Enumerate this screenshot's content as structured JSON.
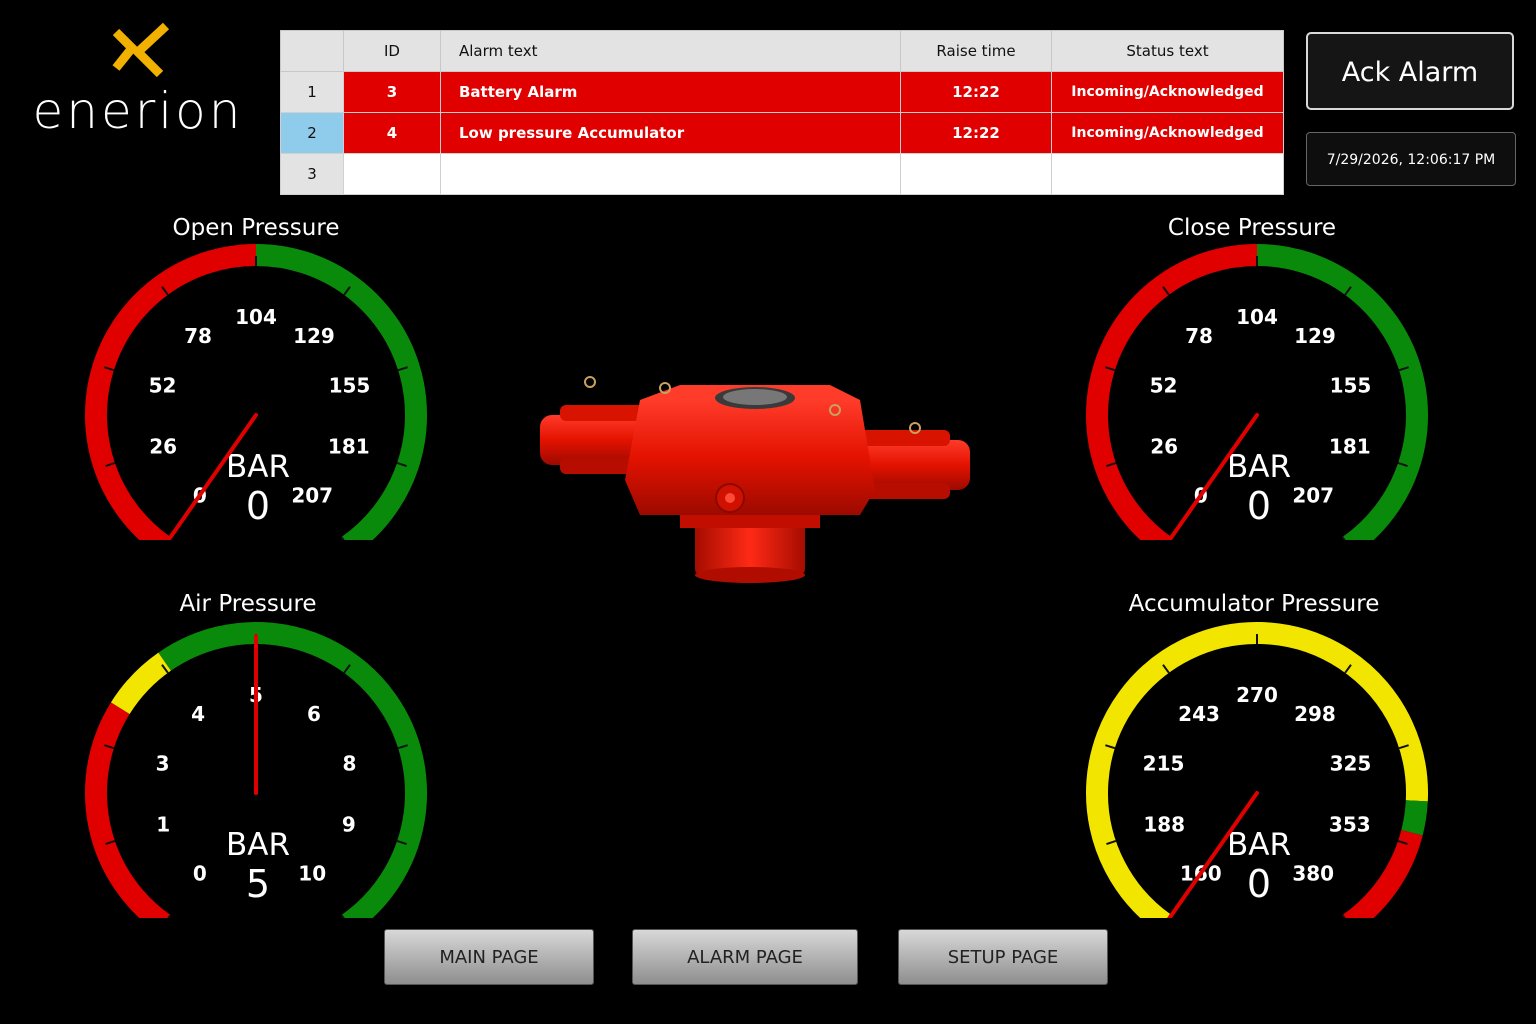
{
  "logo": {
    "text": "enerion",
    "accent": "#f2b000",
    "icon": "x-mark-icon"
  },
  "alarm_table": {
    "headers": {
      "row": "",
      "id": "ID",
      "text": "Alarm text",
      "time": "Raise time",
      "status": "Status text"
    },
    "rows": [
      {
        "row": "1",
        "id": "3",
        "text": "Battery Alarm",
        "time": "12:22",
        "status": "Incoming/Acknowledged"
      },
      {
        "row": "2",
        "id": "4",
        "text": "Low pressure Accumulator",
        "time": "12:22",
        "status": "Incoming/Acknowledged"
      },
      {
        "row": "3",
        "id": "",
        "text": "",
        "time": "",
        "status": ""
      }
    ],
    "alarm_color": "#e00000"
  },
  "ack_button": "Ack Alarm",
  "datetime": "7/29/2026, 12:06:17 PM",
  "gauges": {
    "open": {
      "title": "Open Pressure",
      "unit": "BAR",
      "value": 0,
      "ticks": [
        "0",
        "26",
        "52",
        "78",
        "104",
        "129",
        "155",
        "181",
        "207"
      ]
    },
    "close": {
      "title": "Close Pressure",
      "unit": "BAR",
      "value": 0,
      "ticks": [
        "0",
        "26",
        "52",
        "78",
        "104",
        "129",
        "155",
        "181",
        "207"
      ]
    },
    "air": {
      "title": "Air Pressure",
      "unit": "BAR",
      "value": 5,
      "ticks": [
        "0",
        "1",
        "3",
        "4",
        "5",
        "6",
        "8",
        "9",
        "10"
      ]
    },
    "accumulator": {
      "title": "Accumulator Pressure",
      "unit": "BAR",
      "value": 0,
      "ticks": [
        "160",
        "188",
        "215",
        "243",
        "270",
        "298",
        "325",
        "353",
        "380"
      ]
    }
  },
  "nav": {
    "main": "MAIN PAGE",
    "alarm": "ALARM PAGE",
    "setup": "SETUP PAGE"
  },
  "colors": {
    "red": "#e00000",
    "green": "#0a8a0a",
    "yellow": "#f2e600"
  }
}
